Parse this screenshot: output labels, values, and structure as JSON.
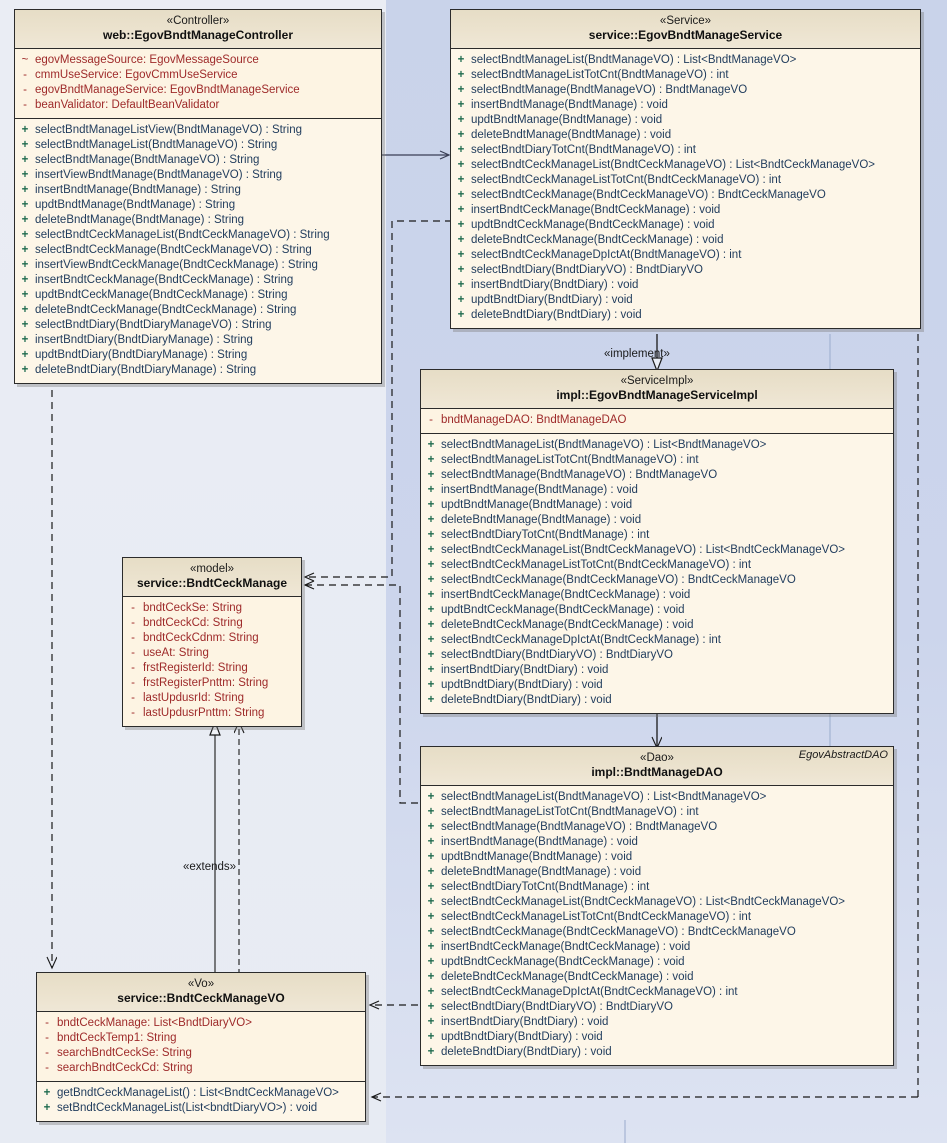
{
  "diagram": {
    "title": "UML Class Diagram - EgovBndtManage",
    "background_left": "#eceff6",
    "background_right": "#ccd5ec"
  },
  "classes": {
    "controller": {
      "stereotype": "«Controller»",
      "name": "web::EgovBndtManageController",
      "attributes": [
        {
          "vis": "~",
          "text": "egovMessageSource:  EgovMessageSource"
        },
        {
          "vis": "-",
          "text": "cmmUseService:  EgovCmmUseService"
        },
        {
          "vis": "-",
          "text": "egovBndtManageService:  EgovBndtManageService"
        },
        {
          "vis": "-",
          "text": "beanValidator:  DefaultBeanValidator"
        }
      ],
      "operations": [
        {
          "vis": "+",
          "text": "selectBndtManageListView(BndtManageVO) : String"
        },
        {
          "vis": "+",
          "text": "selectBndtManageList(BndtManageVO) : String"
        },
        {
          "vis": "+",
          "text": "selectBndtManage(BndtManageVO) : String"
        },
        {
          "vis": "+",
          "text": "insertViewBndtManage(BndtManageVO) : String"
        },
        {
          "vis": "+",
          "text": "insertBndtManage(BndtManage) : String"
        },
        {
          "vis": "+",
          "text": "updtBndtManage(BndtManage) : String"
        },
        {
          "vis": "+",
          "text": "deleteBndtManage(BndtManage) : String"
        },
        {
          "vis": "+",
          "text": "selectBndtCeckManageList(BndtCeckManageVO) : String"
        },
        {
          "vis": "+",
          "text": "selectBndtCeckManage(BndtCeckManageVO) : String"
        },
        {
          "vis": "+",
          "text": "insertViewBndtCeckManage(BndtCeckManage) : String"
        },
        {
          "vis": "+",
          "text": "insertBndtCeckManage(BndtCeckManage) : String"
        },
        {
          "vis": "+",
          "text": "updtBndtCeckManage(BndtCeckManage) : String"
        },
        {
          "vis": "+",
          "text": "deleteBndtCeckManage(BndtCeckManage) : String"
        },
        {
          "vis": "+",
          "text": "selectBndtDiary(BndtDiaryManageVO) : String"
        },
        {
          "vis": "+",
          "text": "insertBndtDiary(BndtDiaryManage) : String"
        },
        {
          "vis": "+",
          "text": "updtBndtDiary(BndtDiaryManage) : String"
        },
        {
          "vis": "+",
          "text": "deleteBndtDiary(BndtDiaryManage) : String"
        }
      ]
    },
    "service": {
      "stereotype": "«Service»",
      "name": "service::EgovBndtManageService",
      "attributes": [],
      "operations": [
        {
          "vis": "+",
          "text": "selectBndtManageList(BndtManageVO) : List<BndtManageVO>"
        },
        {
          "vis": "+",
          "text": "selectBndtManageListTotCnt(BndtManageVO) : int"
        },
        {
          "vis": "+",
          "text": "selectBndtManage(BndtManageVO) : BndtManageVO"
        },
        {
          "vis": "+",
          "text": "insertBndtManage(BndtManage) : void"
        },
        {
          "vis": "+",
          "text": "updtBndtManage(BndtManage) : void"
        },
        {
          "vis": "+",
          "text": "deleteBndtManage(BndtManage) : void"
        },
        {
          "vis": "+",
          "text": "selectBndtDiaryTotCnt(BndtManageVO) : int"
        },
        {
          "vis": "+",
          "text": "selectBndtCeckManageList(BndtCeckManageVO) : List<BndtCeckManageVO>"
        },
        {
          "vis": "+",
          "text": "selectBndtCeckManageListTotCnt(BndtCeckManageVO) : int"
        },
        {
          "vis": "+",
          "text": "selectBndtCeckManage(BndtCeckManageVO) : BndtCeckManageVO"
        },
        {
          "vis": "+",
          "text": "insertBndtCeckManage(BndtCeckManage) : void"
        },
        {
          "vis": "+",
          "text": "updtBndtCeckManage(BndtCeckManage) : void"
        },
        {
          "vis": "+",
          "text": "deleteBndtCeckManage(BndtCeckManage) : void"
        },
        {
          "vis": "+",
          "text": "selectBndtCeckManageDpIctAt(BndtManageVO) : int"
        },
        {
          "vis": "+",
          "text": "selectBndtDiary(BndtDiaryVO) : BndtDiaryVO"
        },
        {
          "vis": "+",
          "text": "insertBndtDiary(BndtDiary) : void"
        },
        {
          "vis": "+",
          "text": "updtBndtDiary(BndtDiary) : void"
        },
        {
          "vis": "+",
          "text": "deleteBndtDiary(BndtDiary) : void"
        }
      ]
    },
    "serviceimpl": {
      "stereotype": "«ServiceImpl»",
      "name": "impl::EgovBndtManageServiceImpl",
      "attributes": [
        {
          "vis": "-",
          "text": "bndtManageDAO:  BndtManageDAO"
        }
      ],
      "operations": [
        {
          "vis": "+",
          "text": "selectBndtManageList(BndtManageVO) : List<BndtManageVO>"
        },
        {
          "vis": "+",
          "text": "selectBndtManageListTotCnt(BndtManageVO) : int"
        },
        {
          "vis": "+",
          "text": "selectBndtManage(BndtManageVO) : BndtManageVO"
        },
        {
          "vis": "+",
          "text": "insertBndtManage(BndtManage) : void"
        },
        {
          "vis": "+",
          "text": "updtBndtManage(BndtManage) : void"
        },
        {
          "vis": "+",
          "text": "deleteBndtManage(BndtManage) : void"
        },
        {
          "vis": "+",
          "text": "selectBndtDiaryTotCnt(BndtManage) : int"
        },
        {
          "vis": "+",
          "text": "selectBndtCeckManageList(BndtCeckManageVO) : List<BndtCeckManageVO>"
        },
        {
          "vis": "+",
          "text": "selectBndtCeckManageListTotCnt(BndtCeckManageVO) : int"
        },
        {
          "vis": "+",
          "text": "selectBndtCeckManage(BndtCeckManageVO) : BndtCeckManageVO"
        },
        {
          "vis": "+",
          "text": "insertBndtCeckManage(BndtCeckManage) : void"
        },
        {
          "vis": "+",
          "text": "updtBndtCeckManage(BndtCeckManage) : void"
        },
        {
          "vis": "+",
          "text": "deleteBndtCeckManage(BndtCeckManage) : void"
        },
        {
          "vis": "+",
          "text": "selectBndtCeckManageDpIctAt(BndtCeckManage) : int"
        },
        {
          "vis": "+",
          "text": "selectBndtDiary(BndtDiaryVO) : BndtDiaryVO"
        },
        {
          "vis": "+",
          "text": "insertBndtDiary(BndtDiary) : void"
        },
        {
          "vis": "+",
          "text": "updtBndtDiary(BndtDiary) : void"
        },
        {
          "vis": "+",
          "text": "deleteBndtDiary(BndtDiary) : void"
        }
      ]
    },
    "dao": {
      "stereotype": "«Dao»",
      "name": "impl::BndtManageDAO",
      "corner_note": "EgovAbstractDAO",
      "attributes": [],
      "operations": [
        {
          "vis": "+",
          "text": "selectBndtManageList(BndtManageVO) : List<BndtManageVO>"
        },
        {
          "vis": "+",
          "text": "selectBndtManageListTotCnt(BndtManageVO) : int"
        },
        {
          "vis": "+",
          "text": "selectBndtManage(BndtManageVO) : BndtManageVO"
        },
        {
          "vis": "+",
          "text": "insertBndtManage(BndtManage) : void"
        },
        {
          "vis": "+",
          "text": "updtBndtManage(BndtManage) : void"
        },
        {
          "vis": "+",
          "text": "deleteBndtManage(BndtManage) : void"
        },
        {
          "vis": "+",
          "text": "selectBndtDiaryTotCnt(BndtManage) : int"
        },
        {
          "vis": "+",
          "text": "selectBndtCeckManageList(BndtCeckManageVO) : List<BndtCeckManageVO>"
        },
        {
          "vis": "+",
          "text": "selectBndtCeckManageListTotCnt(BndtCeckManageVO) : int"
        },
        {
          "vis": "+",
          "text": "selectBndtCeckManage(BndtCeckManageVO) : BndtCeckManageVO"
        },
        {
          "vis": "+",
          "text": "insertBndtCeckManage(BndtCeckManage) : void"
        },
        {
          "vis": "+",
          "text": "updtBndtCeckManage(BndtCeckManage) : void"
        },
        {
          "vis": "+",
          "text": "deleteBndtCeckManage(BndtCeckManage) : void"
        },
        {
          "vis": "+",
          "text": "selectBndtCeckManageDpIctAt(BndtCeckManageVO) : int"
        },
        {
          "vis": "+",
          "text": "selectBndtDiary(BndtDiaryVO) : BndtDiaryVO"
        },
        {
          "vis": "+",
          "text": "insertBndtDiary(BndtDiary) : void"
        },
        {
          "vis": "+",
          "text": "updtBndtDiary(BndtDiary) : void"
        },
        {
          "vis": "+",
          "text": "deleteBndtDiary(BndtDiary) : void"
        }
      ]
    },
    "model": {
      "stereotype": "«model»",
      "name": "service::BndtCeckManage",
      "attributes": [
        {
          "vis": "-",
          "text": "bndtCeckSe:  String"
        },
        {
          "vis": "-",
          "text": "bndtCeckCd:  String"
        },
        {
          "vis": "-",
          "text": "bndtCeckCdnm:  String"
        },
        {
          "vis": "-",
          "text": "useAt:  String"
        },
        {
          "vis": "-",
          "text": "frstRegisterId:  String"
        },
        {
          "vis": "-",
          "text": "frstRegisterPnttm:  String"
        },
        {
          "vis": "-",
          "text": "lastUpdusrId:  String"
        },
        {
          "vis": "-",
          "text": "lastUpdusrPnttm:  String"
        }
      ],
      "operations": []
    },
    "vo": {
      "stereotype": "«Vo»",
      "name": "service::BndtCeckManageVO",
      "attributes": [
        {
          "vis": "-",
          "text": "bndtCeckManage:  List<BndtDiaryVO>"
        },
        {
          "vis": "-",
          "text": "bndtCeckTemp1:  String"
        },
        {
          "vis": "-",
          "text": "searchBndtCeckSe:  String"
        },
        {
          "vis": "-",
          "text": "searchBndtCeckCd:  String"
        }
      ],
      "operations": [
        {
          "vis": "+",
          "text": "getBndtCeckManageList() : List<BndtCeckManageVO>"
        },
        {
          "vis": "+",
          "text": "setBndtCeckManageList(List<bndtDiaryVO>) : void"
        }
      ]
    }
  },
  "edges": [
    {
      "id": "implement",
      "label": "«implement»",
      "kind": "realization"
    },
    {
      "id": "extends",
      "label": "«extends»",
      "kind": "generalization"
    }
  ]
}
